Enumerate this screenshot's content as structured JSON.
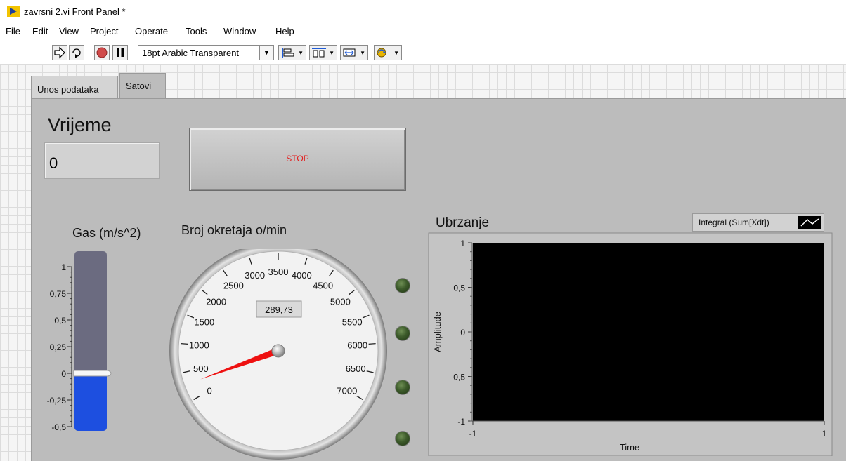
{
  "window": {
    "title": "zavrsni 2.vi Front Panel *"
  },
  "menu": [
    "File",
    "Edit",
    "View",
    "Project",
    "Operate",
    "Tools",
    "Window",
    "Help"
  ],
  "toolbar": {
    "font_select": "18pt Arabic Transparent",
    "icons": [
      "run-arrow-icon",
      "run-continuously-icon",
      "abort-icon",
      "pause-icon",
      "align-objects-icon",
      "distribute-objects-icon",
      "resize-objects-icon",
      "reorder-icon"
    ]
  },
  "tabs": [
    {
      "label": "Unos podataka",
      "selected": false
    },
    {
      "label": "Satovi",
      "selected": true
    }
  ],
  "vrijeme": {
    "label": "Vrijeme",
    "value": "0"
  },
  "stop_button": {
    "label": "STOP"
  },
  "gas": {
    "label": "Gas (m/s^2)",
    "ticks": [
      "1",
      "0,75",
      "0,5",
      "0,25",
      "0",
      "-0,25",
      "-0,5"
    ],
    "range": [
      -0.5,
      1
    ],
    "value": 0,
    "fill_color": "#1d4fe0",
    "track_color": "#6b6b80"
  },
  "speed_gauge": {
    "label": "Broj okretaja o/min",
    "ticks": [
      "0",
      "500",
      "1000",
      "1500",
      "2000",
      "2500",
      "3000",
      "3500",
      "4000",
      "4500",
      "5000",
      "5500",
      "6000",
      "6500",
      "7000"
    ],
    "range": [
      0,
      7000
    ],
    "digital_display": "289,73",
    "value": 289.73,
    "needle_color": "#ee1111"
  },
  "leds": [
    {
      "name": "led-1",
      "on": false
    },
    {
      "name": "led-2",
      "on": false
    },
    {
      "name": "led-3",
      "on": false
    },
    {
      "name": "led-4",
      "on": false
    }
  ],
  "graph": {
    "title": "Ubrzanje",
    "legend_label": "Integral (Sum[Xdt])",
    "xlabel": "Time",
    "ylabel": "Amplitude",
    "y_ticks": [
      "1",
      "0,5",
      "0",
      "-0,5",
      "-1"
    ],
    "x_ticks": [
      "-1",
      "1"
    ],
    "plot_bg": "#000000"
  }
}
